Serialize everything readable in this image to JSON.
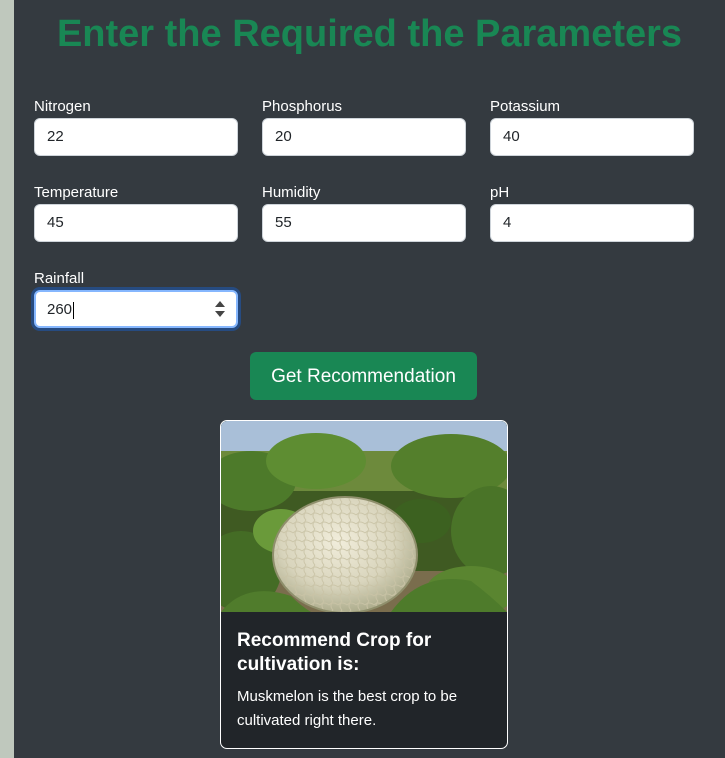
{
  "page": {
    "title": "Enter the Required the Parameters"
  },
  "form": {
    "nitrogen": {
      "label": "Nitrogen",
      "value": "22"
    },
    "phosphorus": {
      "label": "Phosphorus",
      "value": "20"
    },
    "potassium": {
      "label": "Potassium",
      "value": "40"
    },
    "temperature": {
      "label": "Temperature",
      "value": "45"
    },
    "humidity": {
      "label": "Humidity",
      "value": "55"
    },
    "ph": {
      "label": "pH",
      "value": "4"
    },
    "rainfall": {
      "label": "Rainfall",
      "value": "260"
    },
    "submit_label": "Get Recommendation"
  },
  "result": {
    "heading": "Recommend Crop for cultivation is:",
    "text": "Muskmelon is the best crop to be cultivated right there.",
    "image": "muskmelon-photo"
  },
  "colors": {
    "accent": "#198754",
    "panel_bg": "#343a40",
    "card_bg": "#212529",
    "page_bg": "#bfc8bd"
  }
}
